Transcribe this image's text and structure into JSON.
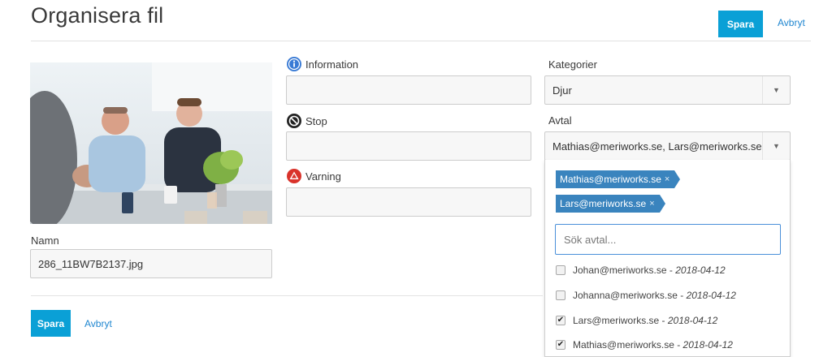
{
  "header": {
    "title": "Organisera fil",
    "save_label": "Spara",
    "cancel_label": "Avbryt"
  },
  "file": {
    "name_label": "Namn",
    "name_value": "286_11BW7B2137.jpg"
  },
  "messages": [
    {
      "label": "Information",
      "icon": "info-icon",
      "color": "#3a7bd5"
    },
    {
      "label": "Stop",
      "icon": "stop-icon",
      "color": "#222222"
    },
    {
      "label": "Varning",
      "icon": "warning-icon",
      "color": "#d9332b"
    }
  ],
  "categories": {
    "label": "Kategorier",
    "value": "Djur"
  },
  "agreements": {
    "label": "Avtal",
    "value": "Mathias@meriworks.se, Lars@meriworks.se",
    "selected_tags": [
      "Mathias@meriworks.se",
      "Lars@meriworks.se"
    ],
    "search_placeholder": "Sök avtal...",
    "options": [
      {
        "email": "Johan@meriworks.se",
        "date": "2018-04-12",
        "checked": false
      },
      {
        "email": "Johanna@meriworks.se",
        "date": "2018-04-12",
        "checked": false
      },
      {
        "email": "Lars@meriworks.se",
        "date": "2018-04-12",
        "checked": true
      },
      {
        "email": "Mathias@meriworks.se",
        "date": "2018-04-12",
        "checked": true
      }
    ]
  },
  "footer": {
    "save_label": "Spara",
    "cancel_label": "Avbryt"
  },
  "colors": {
    "primary": "#0aa0d6",
    "link": "#1f86d0",
    "tag": "#3a84be"
  }
}
